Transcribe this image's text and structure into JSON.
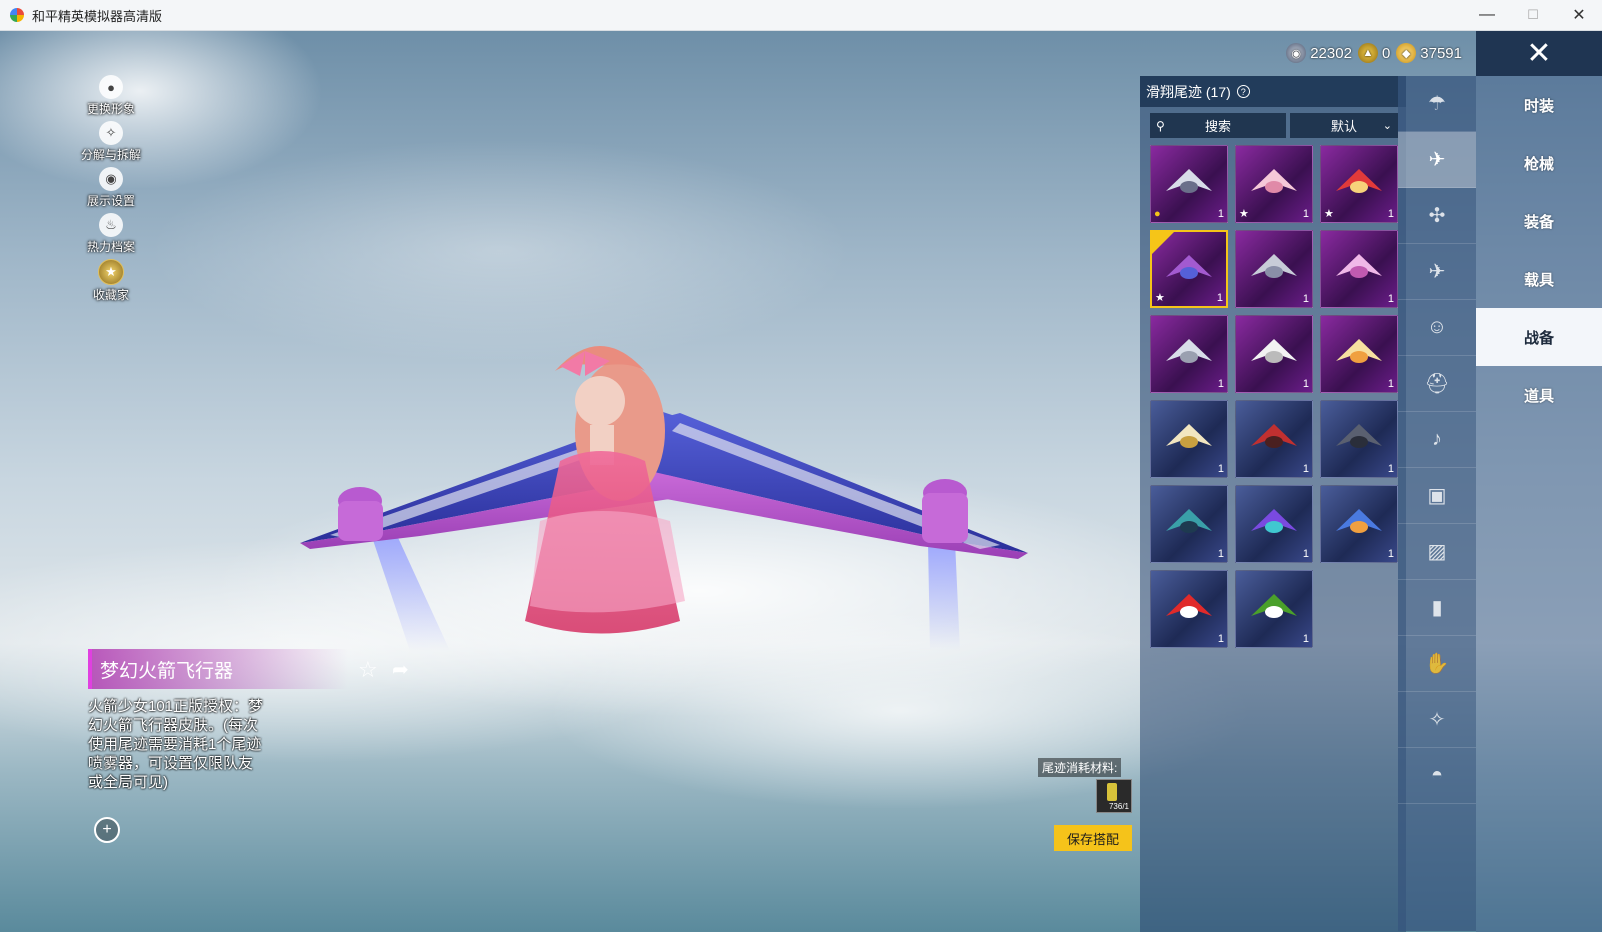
{
  "window": {
    "title": "和平精英模拟器高清版",
    "minimize": "—",
    "maximize": "☐",
    "close": "✕"
  },
  "left_menu": [
    {
      "label": "更换形象",
      "icon": "avatar-icon"
    },
    {
      "label": "分解与拆解",
      "icon": "puzzle-icon"
    },
    {
      "label": "展示设置",
      "icon": "eye-icon"
    },
    {
      "label": "热力档案",
      "icon": "flame-icon"
    },
    {
      "label": "收藏家",
      "icon": "collector-badge-icon"
    }
  ],
  "currency": [
    {
      "icon": "silver-coin-icon",
      "value": "22302"
    },
    {
      "icon": "gold-coin-icon",
      "value": "0"
    },
    {
      "icon": "gold-diamond-icon",
      "value": "37591"
    }
  ],
  "categories": [
    {
      "label": "时装",
      "active": false
    },
    {
      "label": "枪械",
      "active": false
    },
    {
      "label": "装备",
      "active": false
    },
    {
      "label": "载具",
      "active": false
    },
    {
      "label": "战备",
      "active": true
    },
    {
      "label": "道具",
      "active": false
    }
  ],
  "sub_icons": [
    {
      "icon": "parachute-icon",
      "active": false
    },
    {
      "icon": "glider-trail-icon",
      "active": true
    },
    {
      "icon": "drone-icon",
      "active": false
    },
    {
      "icon": "airplane-icon",
      "active": false
    },
    {
      "icon": "emote-face-icon",
      "active": false
    },
    {
      "icon": "helmet-icon",
      "active": false
    },
    {
      "icon": "speaker-icon",
      "active": false
    },
    {
      "icon": "chat-bubble-icon",
      "active": false
    },
    {
      "icon": "picture-icon",
      "active": false
    },
    {
      "icon": "spray-can-icon",
      "active": false
    },
    {
      "icon": "hand-gesture-icon",
      "active": false
    },
    {
      "icon": "magic-wand-icon",
      "active": false
    },
    {
      "icon": "cooked-chicken-icon",
      "active": false
    }
  ],
  "panel": {
    "title": "滑翔尾迹 (17)",
    "help": "?",
    "search_label": "搜索",
    "sort_label": "默认"
  },
  "items": [
    {
      "rarity": "purple",
      "qty": "1",
      "mark": "gold-dot",
      "art": "mecha-wings"
    },
    {
      "rarity": "purple",
      "qty": "1",
      "mark": "star",
      "art": "pink-feather-wings"
    },
    {
      "rarity": "purple",
      "qty": "1",
      "mark": "star",
      "art": "red-chick"
    },
    {
      "rarity": "purple",
      "qty": "1",
      "mark": "star",
      "art": "purple-rocket-glider",
      "selected": true
    },
    {
      "rarity": "purple",
      "qty": "1",
      "mark": "",
      "art": "silver-blade"
    },
    {
      "rarity": "purple",
      "qty": "1",
      "mark": "",
      "art": "crystal-turnip"
    },
    {
      "rarity": "purple",
      "qty": "1",
      "mark": "",
      "art": "ufo"
    },
    {
      "rarity": "purple",
      "qty": "1",
      "mark": "",
      "art": "white-wings"
    },
    {
      "rarity": "purple",
      "qty": "1",
      "mark": "",
      "art": "comet"
    },
    {
      "rarity": "blue",
      "qty": "1",
      "mark": "",
      "art": "gold-jet"
    },
    {
      "rarity": "blue",
      "qty": "1",
      "mark": "",
      "art": "red-fighter"
    },
    {
      "rarity": "blue",
      "qty": "1",
      "mark": "",
      "art": "dark-jet"
    },
    {
      "rarity": "blue",
      "qty": "1",
      "mark": "",
      "art": "teal-fighter"
    },
    {
      "rarity": "blue",
      "qty": "1",
      "mark": "",
      "art": "rainbow-smoke"
    },
    {
      "rarity": "blue",
      "qty": "1",
      "mark": "",
      "art": "rainbow-smoke-2"
    },
    {
      "rarity": "blue",
      "qty": "1",
      "mark": "",
      "art": "red-smoke"
    },
    {
      "rarity": "blue",
      "qty": "1",
      "mark": "",
      "art": "green-smoke"
    }
  ],
  "item_info": {
    "name": "梦幻火箭飞行器",
    "description": "火箭少女101正版授权：梦幻火箭飞行器皮肤。(每次使用尾迹需要消耗1个尾迹喷雾器，可设置仅限队友或全局可见)"
  },
  "consume": {
    "label": "尾迹消耗材料:",
    "count": "736/1"
  },
  "save_button": "保存搭配",
  "colors": {
    "accent_pink": "#e040e0",
    "save_yellow": "#f5c31a",
    "select_gold": "#f5c518",
    "rarity_purple": "#8a2aa0",
    "rarity_blue": "#4a5d9a"
  }
}
